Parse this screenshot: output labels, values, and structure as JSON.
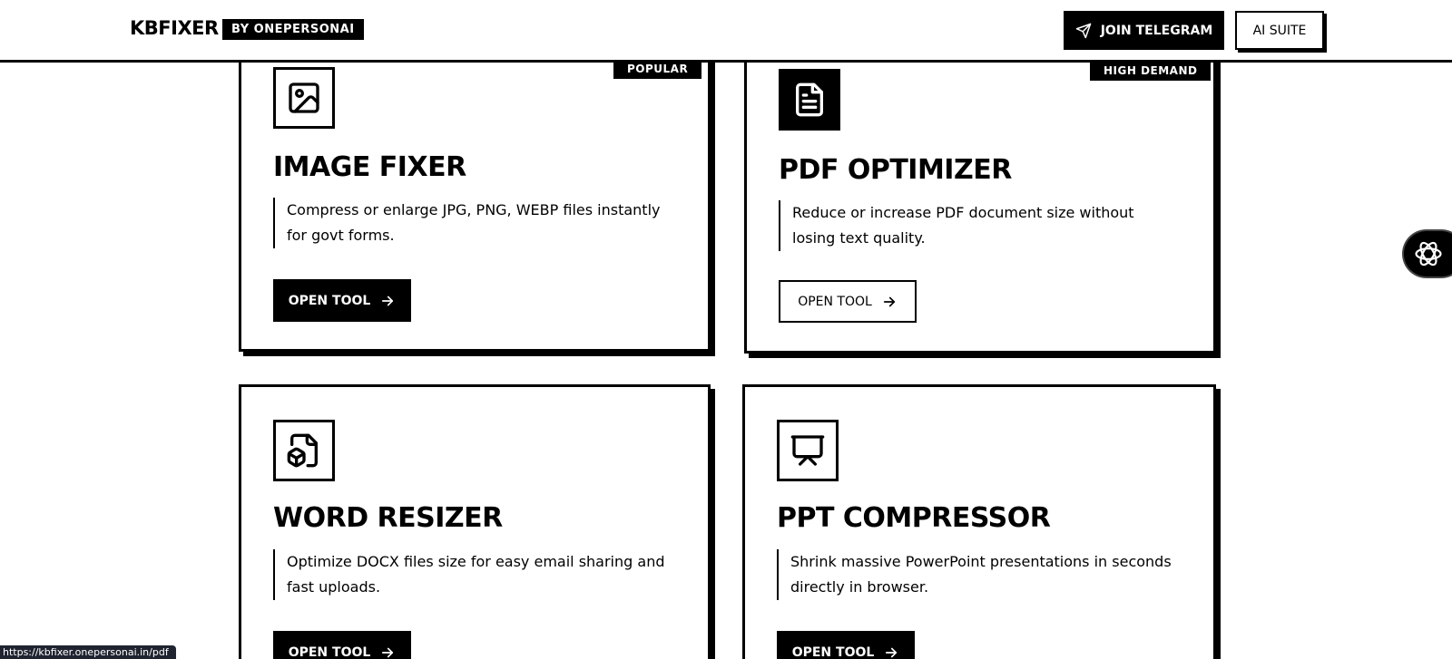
{
  "header": {
    "logo": "KBFIXER",
    "by_badge": "BY ONEPERSONAI",
    "join_telegram": "JOIN TELEGRAM",
    "ai_suite": "AI SUITE"
  },
  "cards": [
    {
      "badge": "POPULAR",
      "title": "IMAGE FIXER",
      "desc": "Compress or enlarge JPG, PNG, WEBP files instantly for govt forms.",
      "button": "OPEN TOOL",
      "icon": "image-icon"
    },
    {
      "badge": "HIGH DEMAND",
      "title": "PDF OPTIMIZER",
      "desc": "Reduce or increase PDF document size without losing text quality.",
      "button": "OPEN TOOL",
      "icon": "document-icon"
    },
    {
      "title": "WORD RESIZER",
      "desc": "Optimize DOCX files size for easy email sharing and fast uploads.",
      "button": "OPEN TOOL",
      "icon": "file-box-icon"
    },
    {
      "title": "PPT COMPRESSOR",
      "desc": "Shrink massive PowerPoint presentations in seconds directly in browser.",
      "button": "OPEN TOOL",
      "icon": "presentation-icon"
    }
  ],
  "status_url": "https://kbfixer.onepersonai.in/pdf",
  "colors": {
    "primary": "#000000",
    "background": "#ffffff"
  }
}
